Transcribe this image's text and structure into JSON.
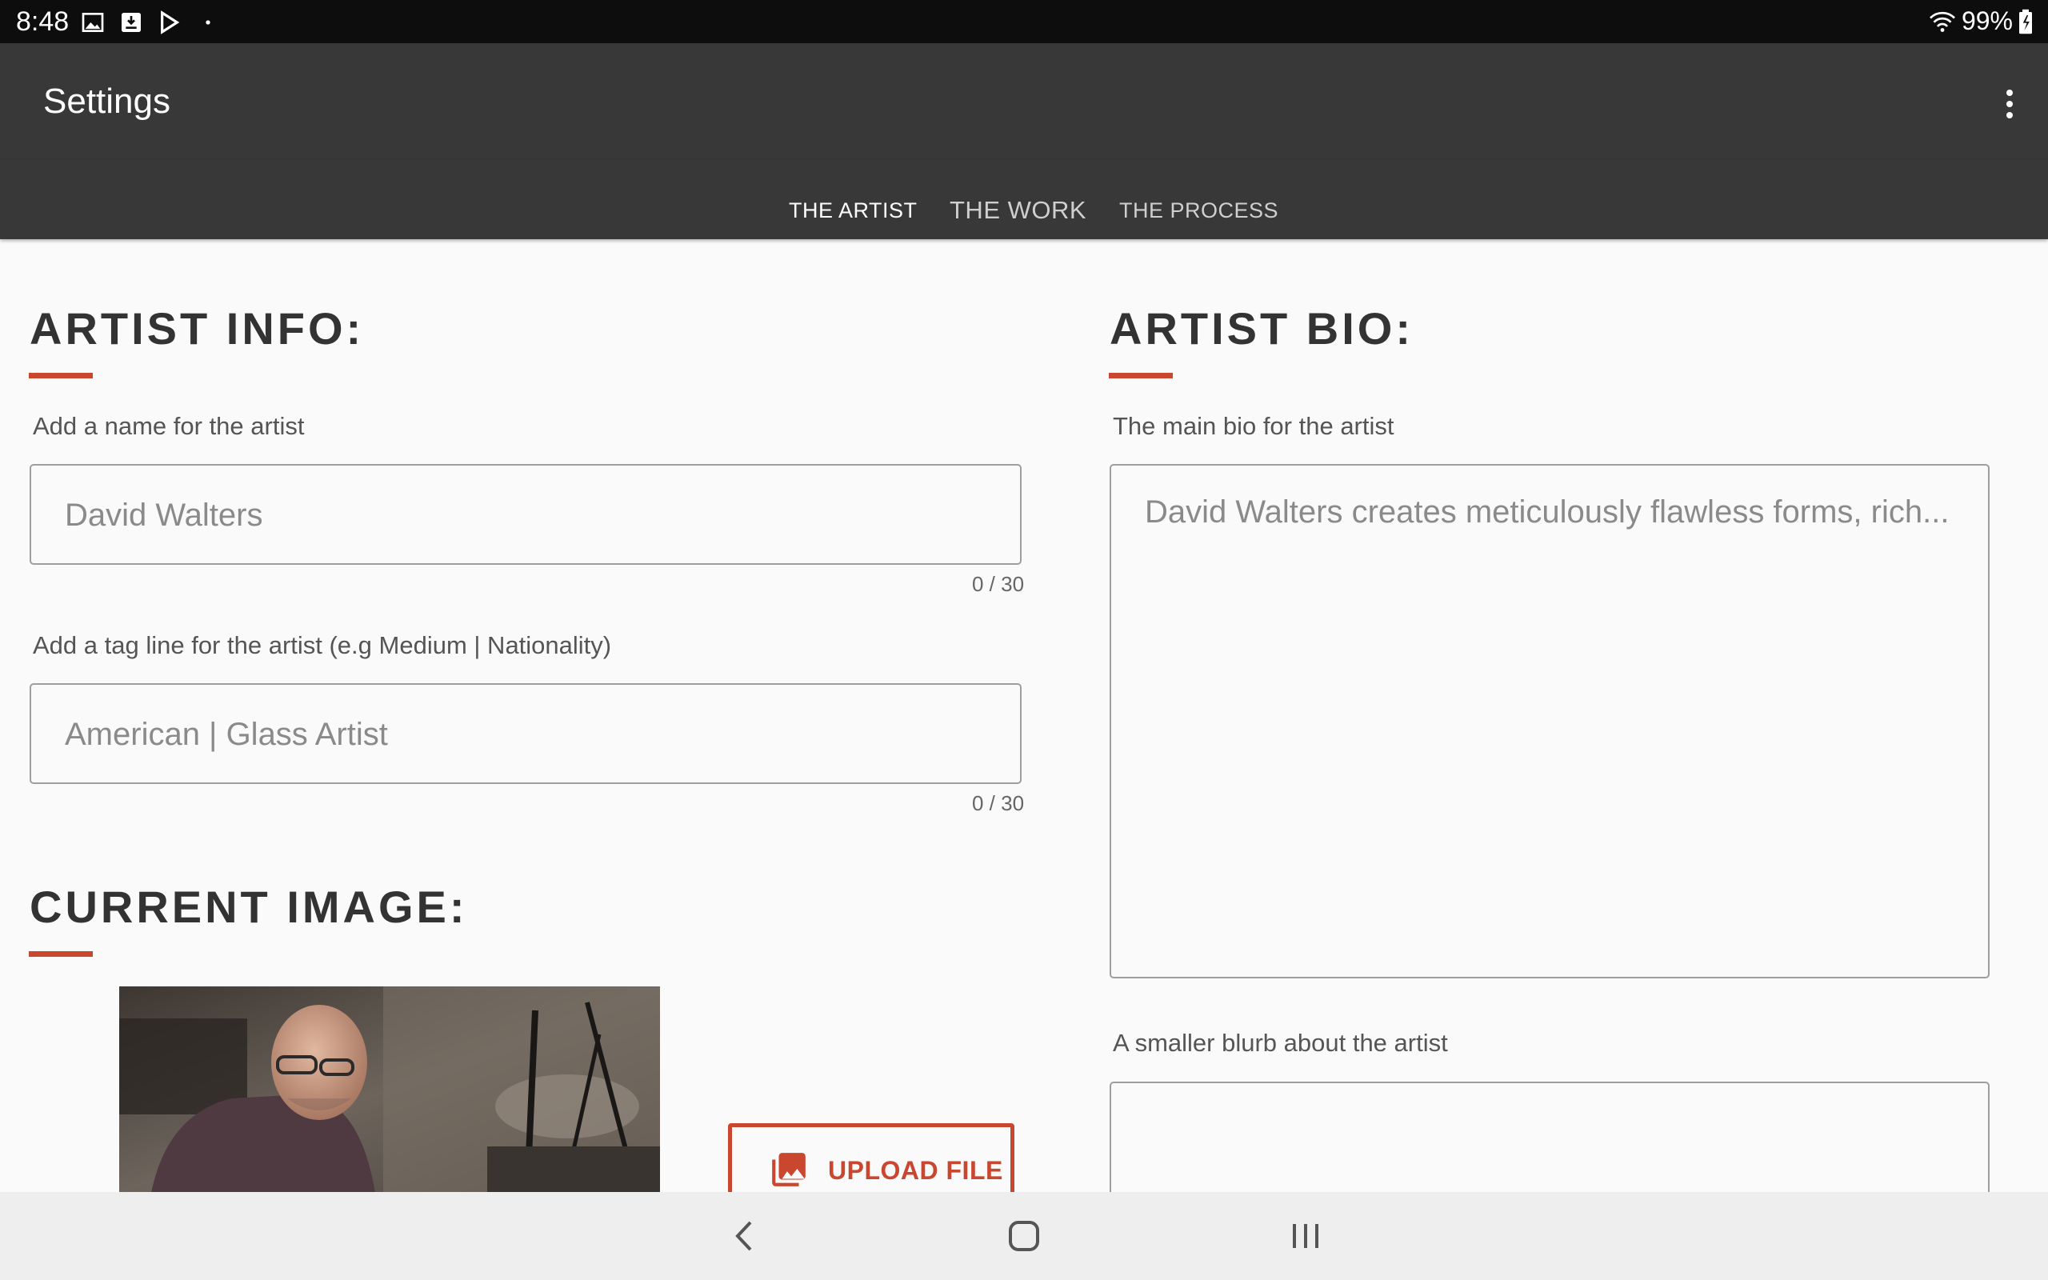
{
  "status_bar": {
    "time": "8:48",
    "notification_icons": [
      "image-icon",
      "download-icon",
      "play-store-icon",
      "dot-icon"
    ],
    "battery": "99%"
  },
  "app_bar": {
    "title": "Settings"
  },
  "tabs": [
    {
      "label": "THE ARTIST",
      "active": true
    },
    {
      "label": "THE WORK",
      "active": false
    },
    {
      "label": "THE PROCESS",
      "active": false
    }
  ],
  "artist_info": {
    "heading": "ARTIST INFO:",
    "name_label": "Add a name for the artist",
    "name_value": "David Walters",
    "name_counter": "0 / 30",
    "tagline_label": "Add a tag line for the artist (e.g Medium | Nationality)",
    "tagline_value": "American | Glass Artist",
    "tagline_counter": "0 / 30"
  },
  "current_image": {
    "heading": "CURRENT IMAGE:",
    "upload_label": "UPLOAD FILE"
  },
  "artist_bio": {
    "heading": "ARTIST BIO:",
    "bio_label": "The main bio for the artist",
    "bio_value": "David Walters creates meticulously flawless forms, rich...",
    "blurb_label": "A smaller blurb about the artist",
    "blurb_value": ""
  },
  "colors": {
    "accent": "#c9472f",
    "app_bar": "#383838",
    "status_bar": "#0d0d0d",
    "background": "#fafafa"
  }
}
